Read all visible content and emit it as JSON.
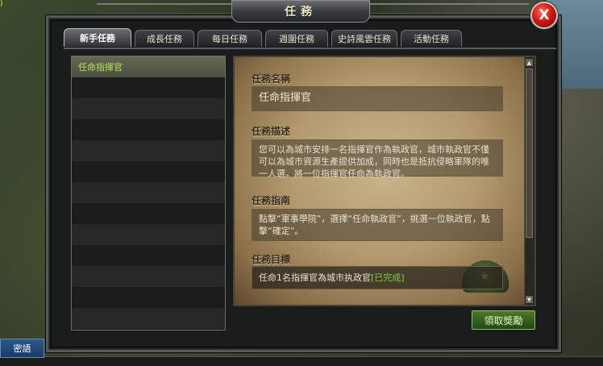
{
  "window": {
    "title": "任務",
    "close_glyph": "X"
  },
  "tabs": [
    {
      "label": "新手任務",
      "active": true
    },
    {
      "label": "成長任務",
      "active": false
    },
    {
      "label": "每日任務",
      "active": false
    },
    {
      "label": "週圍任務",
      "active": false
    },
    {
      "label": "史詩風雲任務",
      "active": false
    },
    {
      "label": "活動任務",
      "active": false
    }
  ],
  "quest_list": {
    "items": [
      "任命指揮官"
    ],
    "selected_index": 0
  },
  "detail": {
    "name_title": "任務名稱",
    "name_value": "任命指揮官",
    "desc_title": "任務描述",
    "desc_value": "您可以為城市安排一名指揮官作為執政官，城市執政官不僅可以為城市資源生產提供加成，同時也是抵抗侵略軍隊的唯一人選。將一位指揮官任命為執政官。",
    "guide_title": "任務指南",
    "guide_value": "點擊“軍事學院”，選擇“任命執政官”，挑選一位執政官，點擊“確定”。",
    "goal_title": "任務目標",
    "goal_value": "任命1名指揮官為城市执政官",
    "goal_status": "[已完成]"
  },
  "claim_button": "領取獎勵",
  "chat_label": "密語",
  "colors": {
    "accent_green": "#b8e05a",
    "done_green": "#7acc3a",
    "close_red": "#d01a10"
  }
}
